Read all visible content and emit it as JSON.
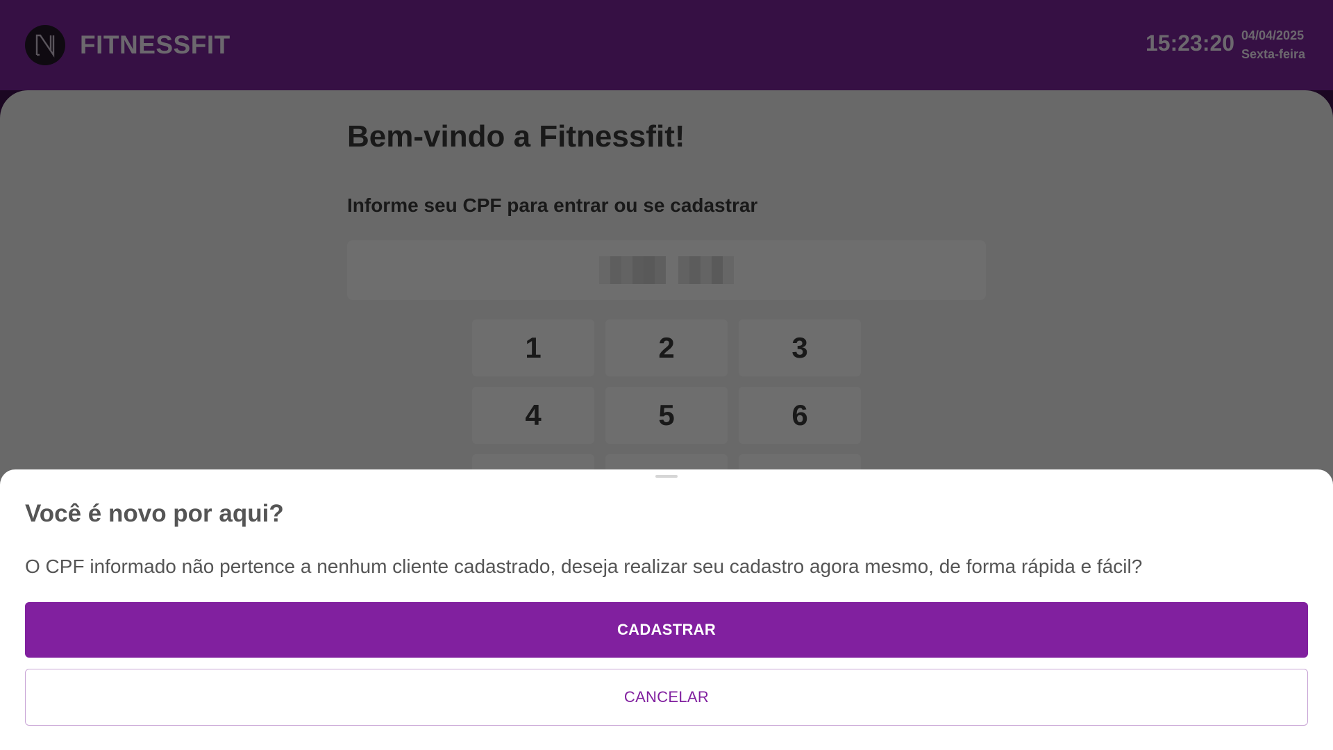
{
  "header": {
    "brand": "FITNESSFIT",
    "time": "15:23:20",
    "date": "04/04/2025",
    "weekday": "Sexta-feira",
    "logo_icon": "n-logo-icon"
  },
  "main": {
    "welcome": "Bem-vindo a Fitnessfit!",
    "prompt": "Informe seu CPF para entrar ou se cadastrar",
    "cpf_masked": true,
    "keypad": [
      "1",
      "2",
      "3",
      "4",
      "5",
      "6"
    ]
  },
  "dialog": {
    "title": "Você é novo por aqui?",
    "message": "O CPF informado não pertence a nenhum cliente cadastrado, deseja realizar seu cadastro agora mesmo, de forma rápida e fácil?",
    "primary_label": "CADASTRAR",
    "secondary_label": "CANCELAR"
  },
  "colors": {
    "header_bg": "#6d2188",
    "accent": "#81209f",
    "accent_border": "#c9a6d6",
    "card_bg": "#d3d3d3"
  }
}
